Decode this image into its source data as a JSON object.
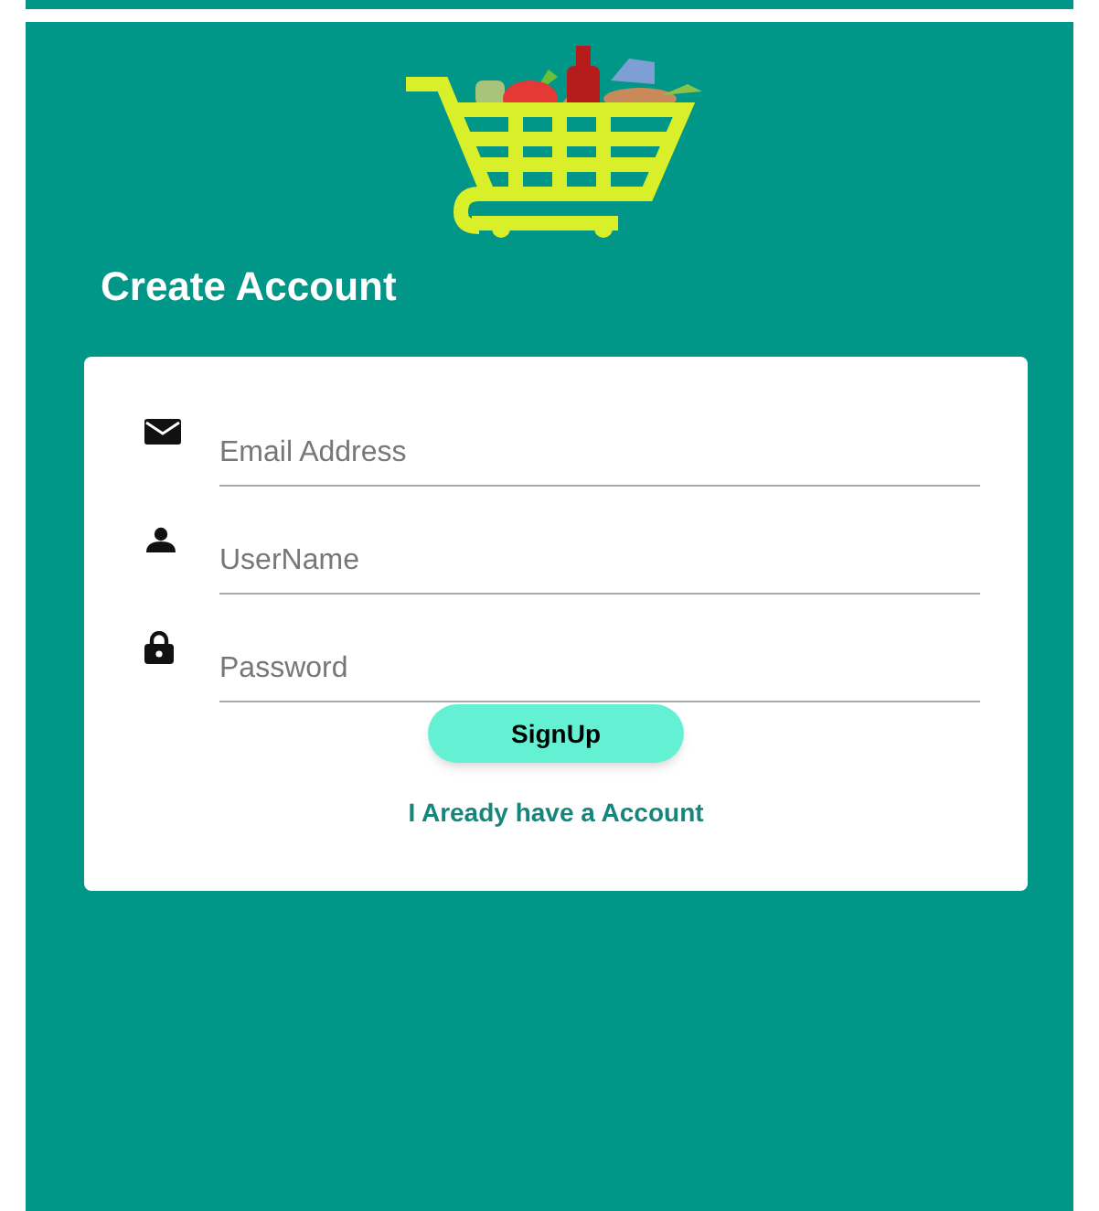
{
  "title": "Create Account",
  "fields": [
    {
      "kind": "email",
      "placeholder": "Email Address"
    },
    {
      "kind": "user",
      "placeholder": "UserName"
    },
    {
      "kind": "password",
      "placeholder": "Password"
    }
  ],
  "button": "SignUp",
  "link": "I Aready have a Account"
}
